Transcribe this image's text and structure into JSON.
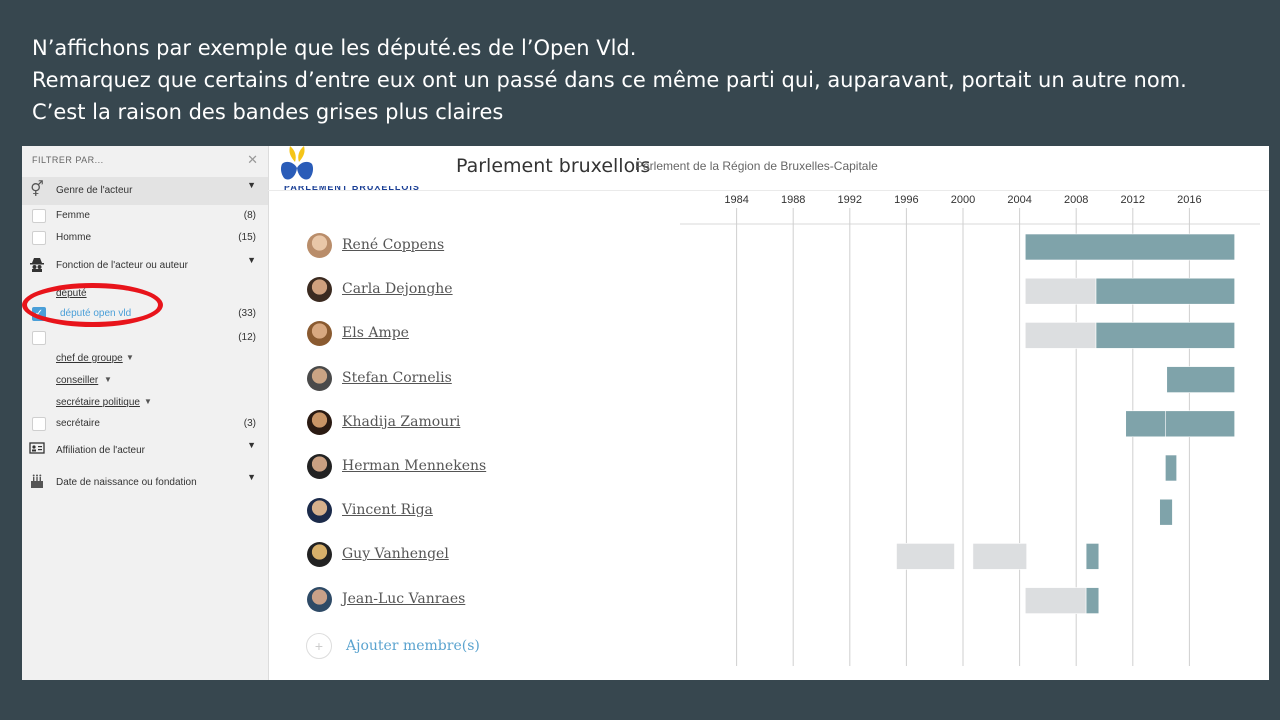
{
  "caption": {
    "line1": "N’affichons par exemple que les député.es de l’Open Vld.",
    "line2": "Remarquez que certains d’entre eux ont un passé dans ce même parti qui, auparavant, portait un autre nom.",
    "line3": "C’est la raison des bandes grises plus claires"
  },
  "sidebar": {
    "title": "Filtrer par...",
    "close_icon": "close-icon",
    "sections": [
      {
        "label": "Genre de l'acteur",
        "icon": "gender-icon"
      },
      {
        "label": "Fonction de l'acteur ou auteur",
        "icon": "spy-icon"
      },
      {
        "label": "Affiliation de l'acteur",
        "icon": "id-card-icon"
      },
      {
        "label": "Date de naissance ou fondation",
        "icon": "birthday-cake-icon"
      }
    ],
    "gender_items": [
      {
        "label": "Femme",
        "count": "(8)"
      },
      {
        "label": "Homme",
        "count": "(15)"
      }
    ],
    "function_items": {
      "depute_link": "député",
      "depute_open_vld": {
        "label": "député open vld",
        "count": "(33)",
        "checked": true
      },
      "hidden_count": "(12)",
      "chef_de_groupe": "chef de groupe",
      "conseiller": "conseiller",
      "secretaire_politique": "secrétaire politique",
      "secretaire": {
        "label": "secrétaire",
        "count": "(3)"
      }
    }
  },
  "header": {
    "title": "Parlement bruxellois",
    "subtitle": "Parlement de la Région de Bruxelles-Capitale",
    "logo_text": "PARLEMENT BRUXELLOIS",
    "accent_color": "#7fa3aa"
  },
  "members": [
    {
      "name": "René Coppens"
    },
    {
      "name": "Carla Dejonghe"
    },
    {
      "name": "Els Ampe"
    },
    {
      "name": "Stefan Cornelis"
    },
    {
      "name": "Khadija Zamouri"
    },
    {
      "name": "Herman Mennekens"
    },
    {
      "name": "Vincent Riga"
    },
    {
      "name": "Guy Vanhengel"
    },
    {
      "name": "Jean-Luc Vanraes"
    }
  ],
  "add_member_label": "Ajouter membre(s)",
  "chart_data": {
    "type": "bar",
    "x_ticks": [
      "1984",
      "1988",
      "1992",
      "1996",
      "2000",
      "2004",
      "2008",
      "2012",
      "2016"
    ],
    "xlim": [
      1980,
      2020
    ],
    "colors": {
      "open_vld": "#7fa3aa",
      "previous_name": "#dcdee0"
    },
    "rows": [
      {
        "member": "René Coppens",
        "bars": [
          {
            "start": 2004.4,
            "end": 2019.2,
            "type": "open_vld"
          }
        ]
      },
      {
        "member": "Carla Dejonghe",
        "bars": [
          {
            "start": 2004.4,
            "end": 2009.4,
            "type": "previous_name"
          },
          {
            "start": 2009.4,
            "end": 2019.2,
            "type": "open_vld"
          }
        ]
      },
      {
        "member": "Els Ampe",
        "bars": [
          {
            "start": 2004.4,
            "end": 2009.4,
            "type": "previous_name"
          },
          {
            "start": 2009.4,
            "end": 2019.2,
            "type": "open_vld"
          }
        ]
      },
      {
        "member": "Stefan Cornelis",
        "bars": [
          {
            "start": 2014.4,
            "end": 2019.2,
            "type": "open_vld"
          }
        ]
      },
      {
        "member": "Khadija Zamouri",
        "bars": [
          {
            "start": 2011.5,
            "end": 2014.3,
            "type": "open_vld"
          },
          {
            "start": 2014.3,
            "end": 2019.2,
            "type": "open_vld"
          }
        ]
      },
      {
        "member": "Herman Mennekens",
        "bars": [
          {
            "start": 2014.3,
            "end": 2015.1,
            "type": "open_vld"
          }
        ]
      },
      {
        "member": "Vincent Riga",
        "bars": [
          {
            "start": 2013.9,
            "end": 2014.8,
            "type": "open_vld"
          }
        ]
      },
      {
        "member": "Guy Vanhengel",
        "bars": [
          {
            "start": 1995.3,
            "end": 1999.4,
            "type": "previous_name"
          },
          {
            "start": 2000.7,
            "end": 2004.5,
            "type": "previous_name"
          },
          {
            "start": 2008.7,
            "end": 2009.6,
            "type": "open_vld"
          }
        ]
      },
      {
        "member": "Jean-Luc Vanraes",
        "bars": [
          {
            "start": 2004.4,
            "end": 2008.7,
            "type": "previous_name"
          },
          {
            "start": 2008.7,
            "end": 2009.6,
            "type": "open_vld"
          }
        ]
      }
    ]
  }
}
